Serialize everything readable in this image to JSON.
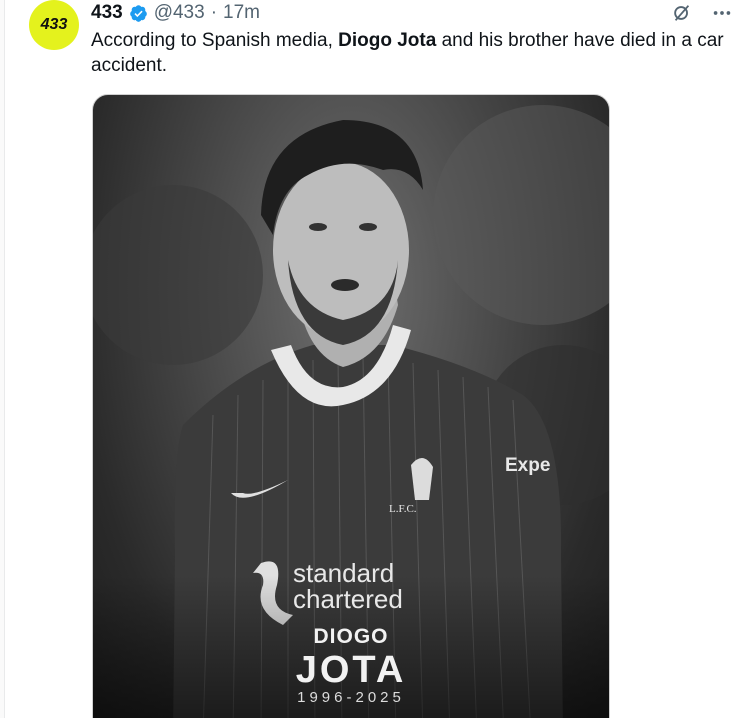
{
  "tweet": {
    "avatar_text": "433",
    "author_name": "433",
    "handle": "@433",
    "separator": "·",
    "time": "17m",
    "text_before": "According to Spanish media, ",
    "text_bold": "Diogo Jota",
    "text_after": " and his brother have died in a car accident."
  },
  "actions": {
    "grok_icon": "grok-icon",
    "more_icon": "more-icon"
  },
  "media": {
    "kit_text_line1": "standard",
    "kit_text_line2": "chartered",
    "kit_sponsor": "Expe",
    "club_crest": "L.F.C.",
    "first_name": "DIOGO",
    "last_name": "JOTA",
    "years": "1996-2025"
  },
  "colors": {
    "avatar_bg": "#e4f21d",
    "verified_blue": "#1d9bf0",
    "muted_text": "#536471"
  }
}
